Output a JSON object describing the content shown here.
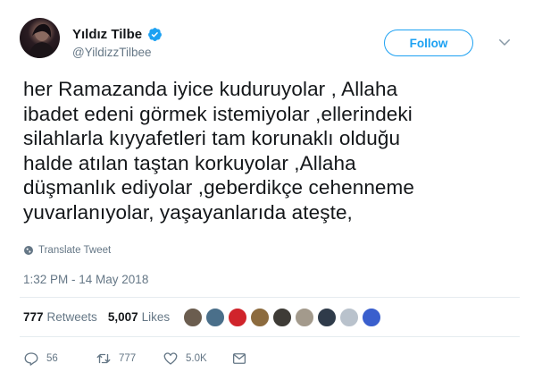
{
  "user": {
    "display_name": "Yıldız Tilbe",
    "handle": "@YildizzTilbee",
    "verified": true
  },
  "follow_button": {
    "label": "Follow"
  },
  "tweet": {
    "text": "her Ramazanda iyice kuduruyolar , Allaha\nibadet edeni görmek istemiyolar ,ellerindeki\nsilahlarla kıyyafetleri tam korunaklı olduğu\nhalde atılan taştan korkuyolar ,Allaha\ndüşmanlık ediyolar ,geberdikçe cehenneme\nyuvarlanıyolar, yaşayanlarıda ateşte,",
    "translate_label": "Translate Tweet",
    "timestamp": "1:32 PM - 14 May 2018"
  },
  "stats": {
    "retweets_count": "777",
    "retweets_label": "Retweets",
    "likes_count": "5,007",
    "likes_label": "Likes"
  },
  "liker_avatars": [
    {
      "name": "liker-avatar",
      "color": "#6b5d4f"
    },
    {
      "name": "liker-avatar",
      "color": "#4a6f8a"
    },
    {
      "name": "liker-avatar",
      "color": "#d0242b"
    },
    {
      "name": "liker-avatar",
      "color": "#8c6b3e"
    },
    {
      "name": "liker-avatar",
      "color": "#3e3b36"
    },
    {
      "name": "liker-avatar",
      "color": "#a39a8c"
    },
    {
      "name": "liker-avatar",
      "color": "#2f3b4a"
    },
    {
      "name": "liker-avatar",
      "color": "#b9c2cc"
    },
    {
      "name": "liker-avatar",
      "color": "#3a5fcd"
    }
  ],
  "actions": {
    "reply_count": "56",
    "retweet_count": "777",
    "like_count": "5.0K"
  },
  "colors": {
    "accent": "#1da1f2",
    "muted": "#657786",
    "text": "#14171a",
    "divider": "#e6ecf0"
  }
}
